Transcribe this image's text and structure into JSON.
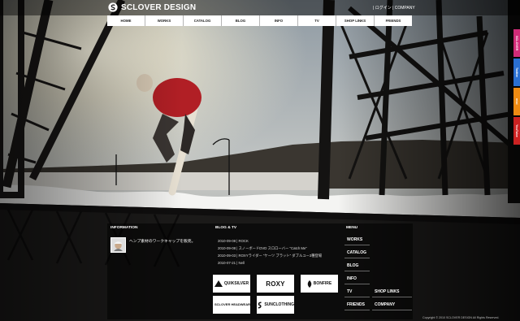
{
  "header": {
    "logo_text": "SCLOVER DESIGN",
    "account_links": "| ログイン | COMPANY"
  },
  "nav": {
    "items": [
      {
        "label": "HOME",
        "name": "nav-home"
      },
      {
        "label": "WORKS",
        "name": "nav-works"
      },
      {
        "label": "CATALOG",
        "name": "nav-catalog"
      },
      {
        "label": "BLOG",
        "name": "nav-blog"
      },
      {
        "label": "INFO",
        "name": "nav-info"
      },
      {
        "label": "TV",
        "name": "nav-tv"
      },
      {
        "label": "SHOP LINKS",
        "name": "nav-shop-links"
      },
      {
        "label": "FRIENDS",
        "name": "nav-friends"
      }
    ]
  },
  "side_tabs": [
    {
      "label": "SCLOVER",
      "color": "#d12b78"
    },
    {
      "label": "Twitter",
      "color": "#2a6fd1"
    },
    {
      "label": "mixi",
      "color": "#ee8a12"
    },
    {
      "label": "YouTube",
      "color": "#cc2222"
    }
  ],
  "information": {
    "title": "INFORMATION",
    "text": "ヘンプ素材のワークキャップを販売。"
  },
  "blog_tv": {
    "title": "BLOG & TV",
    "items": [
      "2010-09-08 | ROCK",
      "2010-09-08 | スノーボードDVD スロローバー \"Catch Me\"",
      "2010-09-03 | ROXYライダー \"ケーツ ブラット\" ダブルユー3種登場",
      "2010-07-21 | Nell"
    ]
  },
  "brands": [
    {
      "label": "QUIKSILVER",
      "name": "brand-quiksilver",
      "style": ""
    },
    {
      "label": "ROXY",
      "name": "brand-roxy",
      "style": "big"
    },
    {
      "label": "BONFIRE",
      "name": "brand-bonfire",
      "style": ""
    },
    {
      "label": "SCLOVER HEADWEAR",
      "name": "brand-sclover-headwear",
      "style": "stack"
    },
    {
      "label": "SUNCLOTHING",
      "name": "brand-sunclothing",
      "style": ""
    }
  ],
  "menu": {
    "title": "MENU",
    "works": "WORKS",
    "catalog": "CATALOG",
    "blog": "BLOG",
    "info": "INFO",
    "tv": "TV",
    "shop_links": "SHOP LINKS",
    "friends": "FRIENDS",
    "company": "COMPANY"
  },
  "footer": {
    "copyright": "Copyright © 2010 SCLOVER DESIGN All Rights Reserved."
  }
}
